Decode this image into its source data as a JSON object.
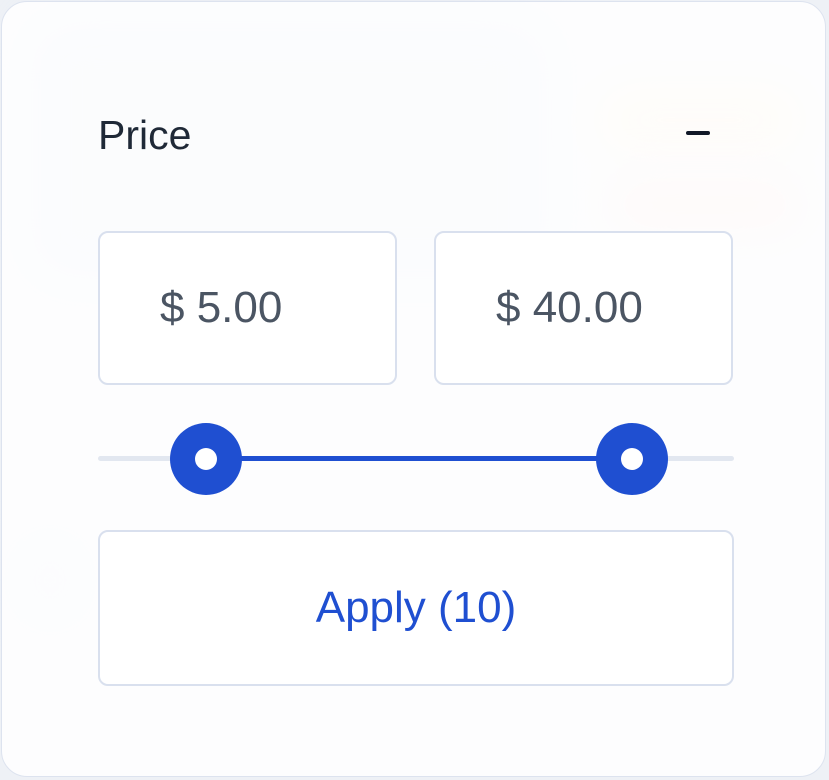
{
  "filter": {
    "title": "Price",
    "collapse_icon": "minus-icon",
    "min_value": "$ 5.00",
    "max_value": "$ 40.00",
    "slider": {
      "min_fraction": 0.17,
      "max_fraction": 0.84
    },
    "apply_label": "Apply (10)"
  },
  "colors": {
    "accent": "#1f4fd1",
    "title": "#1f2937",
    "field_text": "#4b5563",
    "border": "#d9e0ee",
    "track": "#e2e7f0"
  }
}
